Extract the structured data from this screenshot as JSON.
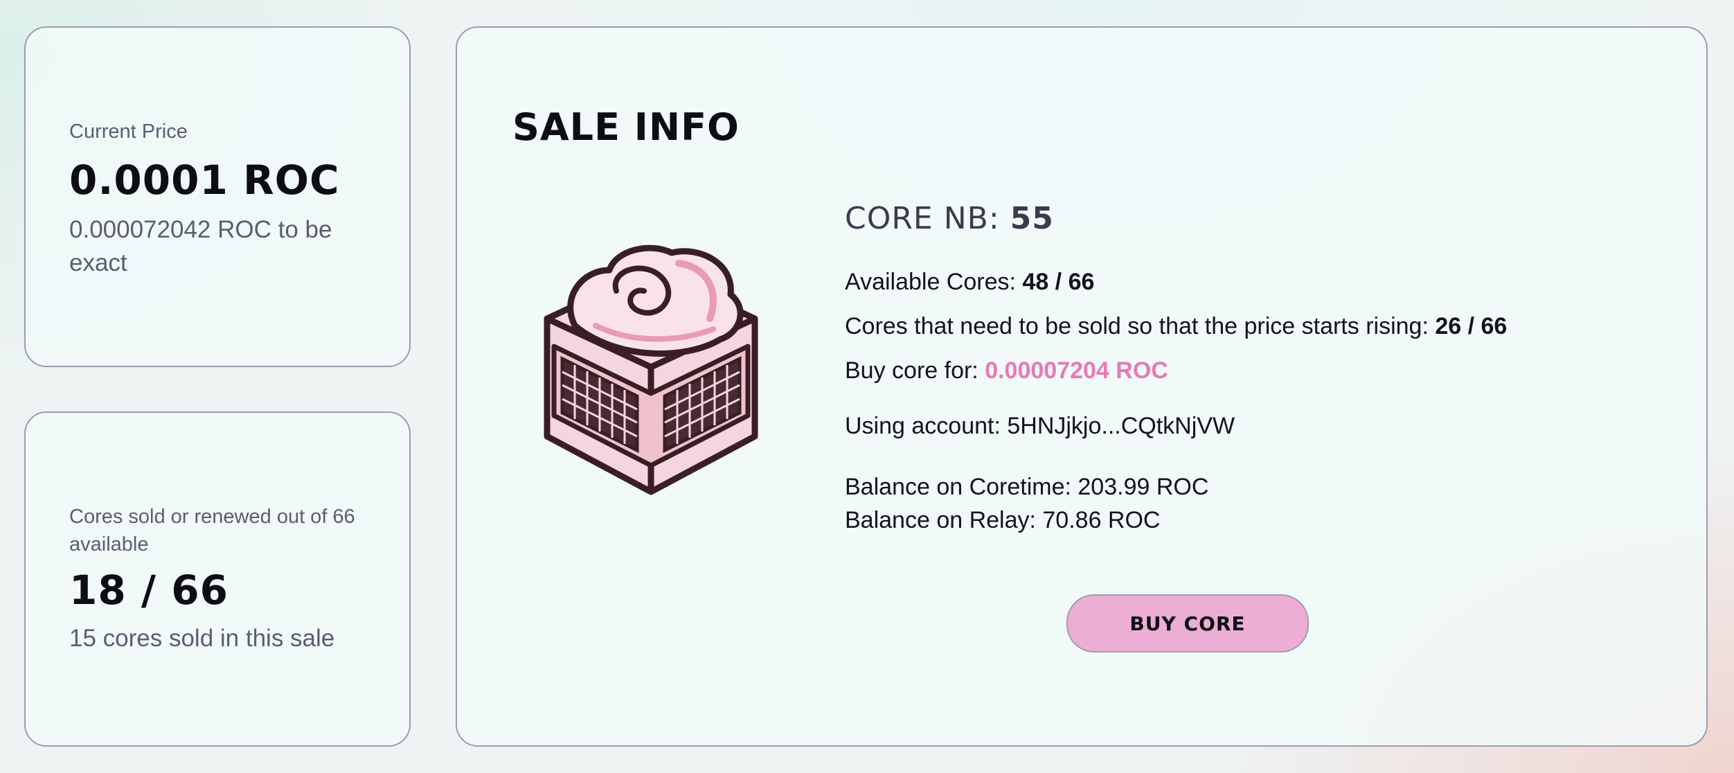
{
  "current_price": {
    "label": "Current Price",
    "value": "0.0001 ROC",
    "exact": "0.000072042 ROC to be exact"
  },
  "cores_sold": {
    "label": "Cores sold or renewed out of 66 available",
    "value": "18 / 66",
    "sub": "15 cores sold in this sale"
  },
  "sale_info": {
    "title": "SALE INFO",
    "core_nb_label": "CORE NB:",
    "core_nb_value": "55",
    "available_cores_label": "Available Cores:",
    "available_cores_value": "48 / 66",
    "cores_needed_label": "Cores that need to be sold so that the price starts rising:",
    "cores_needed_value": "26 / 66",
    "buy_for_label": "Buy core for:",
    "buy_for_value": "0.00007204 ROC",
    "account_label": "Using account:",
    "account_value": "5HNJjkjo...CQtkNjVW",
    "balance_coretime": "Balance on Coretime: 203.99 ROC",
    "balance_relay": "Balance on Relay: 70.86 ROC",
    "buy_button_label": "BUY CORE"
  },
  "colors": {
    "accent_pink": "#e77ab4",
    "button_bg": "#ecaed3",
    "card_border": "#9c9cb0"
  },
  "icons": {
    "core_image": "pink-core-chip-illustration"
  }
}
